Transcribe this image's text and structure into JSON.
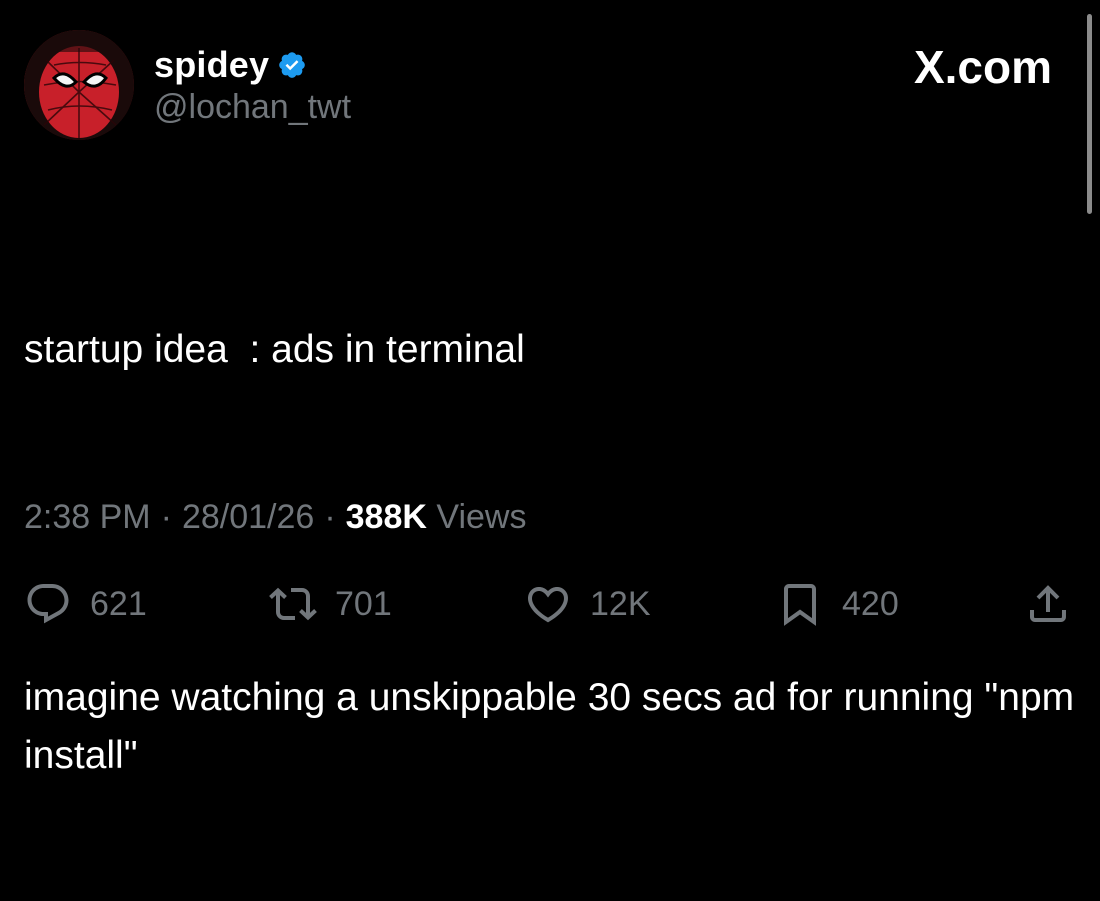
{
  "author": {
    "display_name": "spidey",
    "handle": "@lochan_twt",
    "verified": true
  },
  "brand": {
    "label": "X.com"
  },
  "tweet": {
    "lines": [
      "startup idea  : ads in terminal",
      "imagine watching a unskippable 30 secs ad for running \"npm install\""
    ]
  },
  "meta": {
    "time": "2:38 PM",
    "date": "28/01/26",
    "views_count": "388K",
    "views_label": "Views",
    "separator": "·"
  },
  "actions": {
    "replies": "621",
    "reposts": "701",
    "likes": "12K",
    "bookmarks": "420"
  },
  "colors": {
    "background": "#000000",
    "text": "#ffffff",
    "muted": "#71767b",
    "verified": "#1d9bf0"
  },
  "icons": {
    "reply": "reply-icon",
    "repost": "repost-icon",
    "like": "heart-icon",
    "bookmark": "bookmark-icon",
    "share": "share-icon",
    "verified": "verified-badge-icon"
  }
}
